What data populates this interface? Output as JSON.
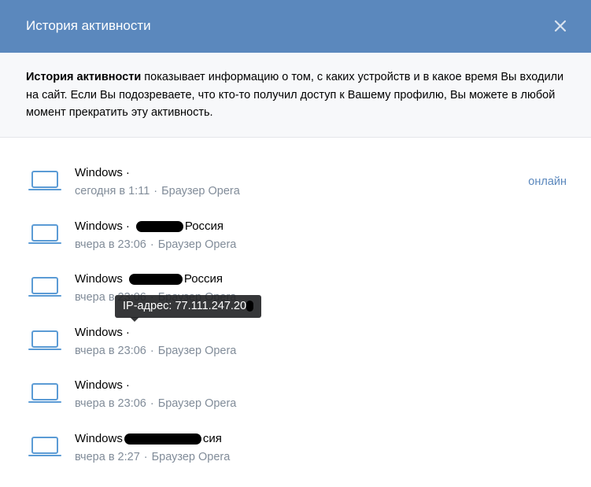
{
  "header": {
    "title": "История активности",
    "close_icon": "close-icon"
  },
  "info": {
    "bold_text": "История активности",
    "text": " показывает информацию о том, с каких устройств и в какое время Вы входили на сайт. Если Вы подозреваете, что кто-то получил доступ к Вашему профилю, Вы можете в любой момент прекратить эту активность."
  },
  "sessions": [
    {
      "os": "Windows",
      "sep": "·",
      "country": "",
      "time": "сегодня в 1:11",
      "dot": "·",
      "browser": "Браузер Opera",
      "status": "онлайн"
    },
    {
      "os": "Windows",
      "sep": "·",
      "country": "Россия",
      "time": "вчера в 23:06",
      "dot": "·",
      "browser": "Браузер Opera",
      "status": ""
    },
    {
      "os": "Windows",
      "sep": "",
      "country": "Россия",
      "time": "вчера в 23:06",
      "dot": "·",
      "browser": "Браузер Opera",
      "status": ""
    },
    {
      "os": "Windows",
      "sep": "·",
      "country": "",
      "time": "вчера в 23:06",
      "dot": "·",
      "browser": "Браузер Opera",
      "status": ""
    },
    {
      "os": "Windows",
      "sep": "·",
      "country": "",
      "time": "вчера в 23:06",
      "dot": "·",
      "browser": "Браузер Opera",
      "status": ""
    },
    {
      "os": "Windows",
      "sep": "",
      "country": "сия",
      "time": "вчера в 2:27",
      "dot": "·",
      "browser": "Браузер Opera",
      "status": ""
    }
  ],
  "tooltip": {
    "label": "IP-адрес: 77.111.247.20"
  },
  "colors": {
    "header_bg": "#5b88bd",
    "accent": "#5b88bd",
    "muted_text": "#818c99",
    "info_bg": "#f7f8fa"
  }
}
